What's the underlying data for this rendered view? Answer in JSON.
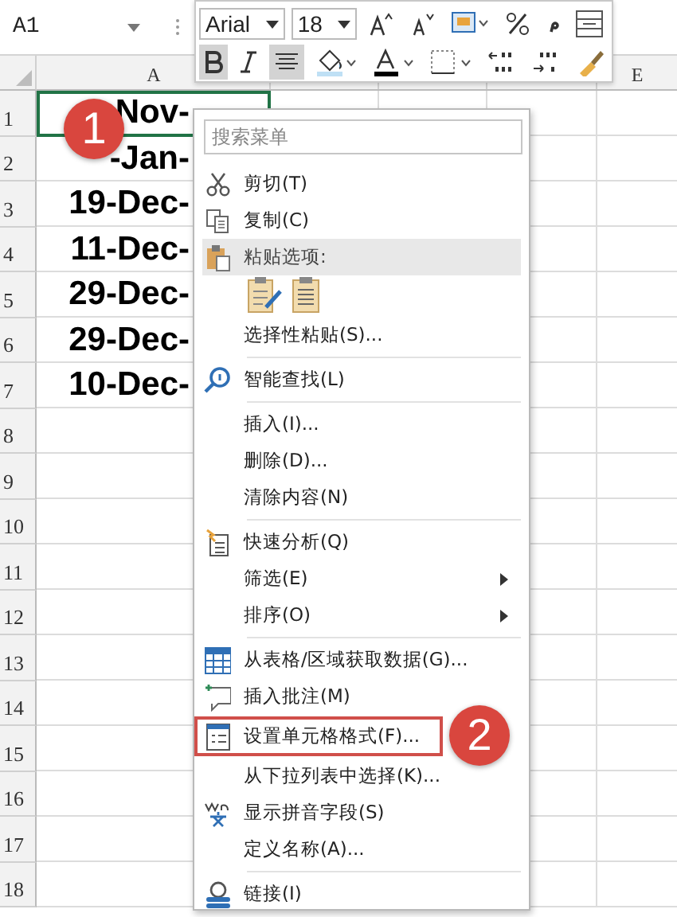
{
  "name_box": {
    "value": "A1"
  },
  "mini_toolbar": {
    "font": "Arial",
    "size": "18",
    "format_buttons": [
      {
        "selected": true
      },
      {
        "selected": false
      },
      {
        "selected": true
      }
    ]
  },
  "column_headers": [
    "A",
    "E"
  ],
  "rows": [
    {
      "header": "1",
      "cell_a": "Nov-",
      "selected": true
    },
    {
      "header": "2",
      "cell_a": "-Jan-",
      "selected": false
    },
    {
      "header": "3",
      "cell_a": "19-Dec-",
      "selected": false
    },
    {
      "header": "4",
      "cell_a": "11-Dec-",
      "selected": false
    },
    {
      "header": "5",
      "cell_a": "29-Dec-",
      "selected": false
    },
    {
      "header": "6",
      "cell_a": "29-Dec-",
      "selected": false
    },
    {
      "header": "7",
      "cell_a": "10-Dec-",
      "selected": false
    },
    {
      "header": "8",
      "selected": false
    },
    {
      "header": "9",
      "selected": false
    },
    {
      "header": "10",
      "selected": false
    },
    {
      "header": "11",
      "selected": false
    },
    {
      "header": "12",
      "selected": false
    },
    {
      "header": "13",
      "selected": false
    },
    {
      "header": "14",
      "selected": false
    },
    {
      "header": "15",
      "selected": false
    },
    {
      "header": "16",
      "selected": false
    },
    {
      "header": "17",
      "selected": false
    },
    {
      "header": "18",
      "selected": false
    }
  ],
  "context_menu": {
    "search_placeholder": "搜索菜单",
    "items": [
      {
        "kind": "item",
        "label": "剪切(T)"
      },
      {
        "kind": "item",
        "label": "复制(C)"
      },
      {
        "kind": "header",
        "label": "粘贴选项:"
      },
      {
        "kind": "paste_icons"
      },
      {
        "kind": "item",
        "label": "选择性粘贴(S)..."
      },
      {
        "kind": "item",
        "label": "智能查找(L)",
        "separator_before": true
      },
      {
        "kind": "item",
        "label": "插入(I)...",
        "separator_before": true
      },
      {
        "kind": "item",
        "label": "删除(D)..."
      },
      {
        "kind": "item",
        "label": "清除内容(N)"
      },
      {
        "kind": "item",
        "label": "快速分析(Q)",
        "separator_before": true
      },
      {
        "kind": "item",
        "label": "筛选(E)",
        "submenu": true
      },
      {
        "kind": "item",
        "label": "排序(O)",
        "submenu": true
      },
      {
        "kind": "item",
        "label": "从表格/区域获取数据(G)...",
        "separator_before": true
      },
      {
        "kind": "item",
        "label": "插入批注(M)"
      },
      {
        "kind": "item",
        "label": "设置单元格格式(F)...",
        "callout": "2"
      },
      {
        "kind": "item",
        "label": "从下拉列表中选择(K)..."
      },
      {
        "kind": "item",
        "label": "显示拼音字段(S)"
      },
      {
        "kind": "item",
        "label": "定义名称(A)..."
      },
      {
        "kind": "item",
        "label": "链接(I)",
        "separator_before": true
      }
    ]
  },
  "callouts": [
    {
      "label": "1"
    }
  ]
}
